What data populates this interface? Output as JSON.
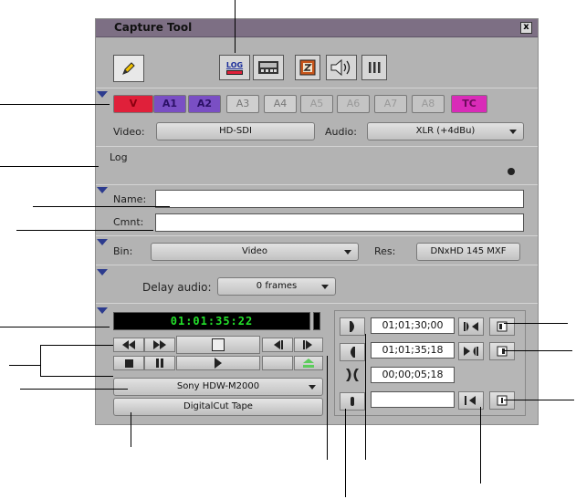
{
  "window": {
    "title": "Capture Tool",
    "close_label": "x"
  },
  "toolbar": {
    "log_icon_label": "LOG"
  },
  "tracks": [
    "V",
    "A1",
    "A2",
    "A3",
    "A4",
    "A5",
    "A6",
    "A7",
    "A8",
    "TC"
  ],
  "source": {
    "video_label": "Video:",
    "video_value": "HD-SDI",
    "audio_label": "Audio:",
    "audio_value": "XLR (+4dBu)"
  },
  "log": {
    "label": "Log"
  },
  "clip": {
    "name_label": "Name:",
    "name_value": "",
    "comment_label": "Cmnt:",
    "comment_value": ""
  },
  "bin": {
    "label": "Bin:",
    "value": "Video",
    "res_label": "Res:",
    "res_value": "DNxHD 145  MXF"
  },
  "delay": {
    "label": "Delay audio:",
    "value": "0 frames"
  },
  "deck": {
    "timecode": "01:01:35:22",
    "deck_name": "Sony  HDW-M2000",
    "tape_name": "DigitalCut Tape"
  },
  "marks": {
    "mark_in": "01;01;30;00",
    "mark_out": "01;01;35;18",
    "duration": "00;00;05;18",
    "pause": ""
  }
}
